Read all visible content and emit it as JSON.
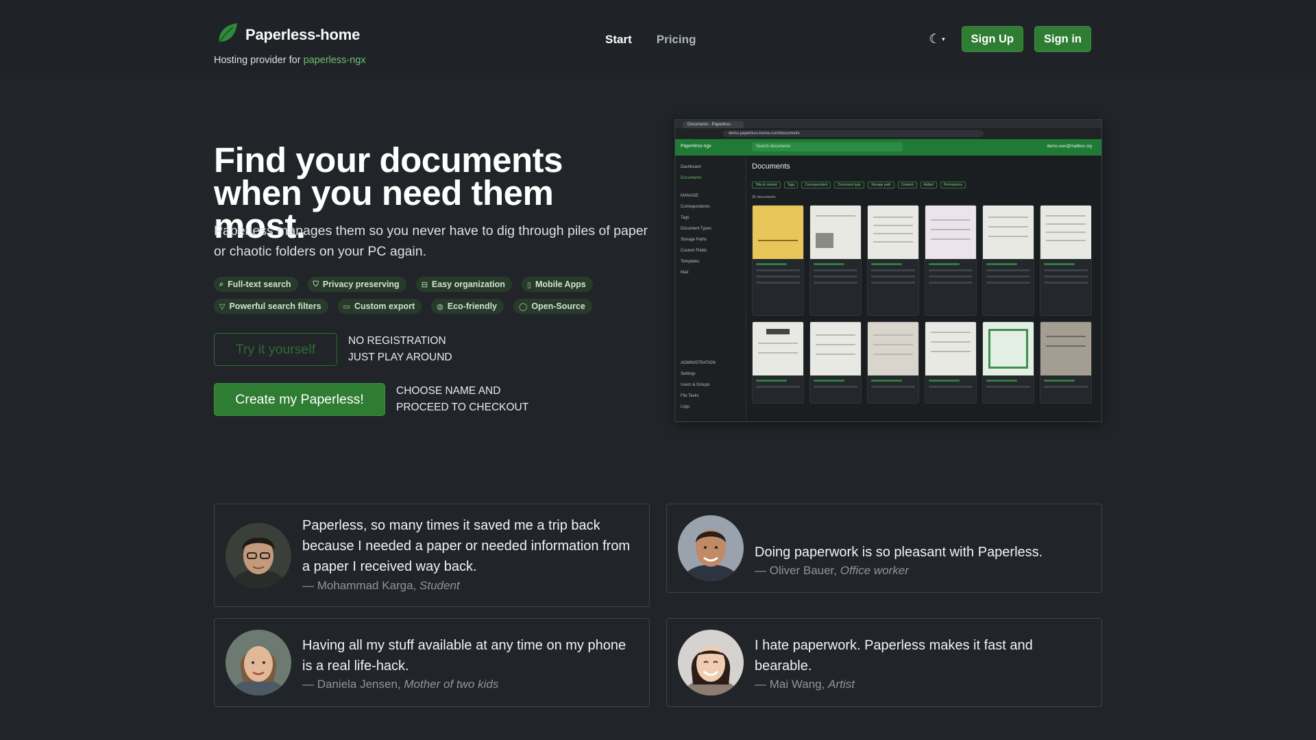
{
  "header": {
    "brand_name": "Paperless-home",
    "brand_sub_prefix": "Hosting provider for",
    "brand_sub_link": "paperless-ngx",
    "nav": [
      {
        "label": "Start",
        "active": true
      },
      {
        "label": "Pricing",
        "active": false
      }
    ],
    "theme_icon": "moon-icon",
    "signup_label": "Sign Up",
    "signin_label": "Sign in"
  },
  "hero": {
    "title": "Find your documents when you need them most.",
    "lead": "Paperless manages them so you never have to dig through piles of paper or chaotic folders on your PC again.",
    "features": [
      {
        "label": "Full-text search",
        "icon": "search-icon"
      },
      {
        "label": "Privacy preserving",
        "icon": "shield-icon"
      },
      {
        "label": "Easy organization",
        "icon": "inbox-icon"
      },
      {
        "label": "Mobile Apps",
        "icon": "phone-icon"
      },
      {
        "label": "Powerful search filters",
        "icon": "filter-icon"
      },
      {
        "label": "Custom export",
        "icon": "folder-icon"
      },
      {
        "label": "Eco-friendly",
        "icon": "globe-icon"
      },
      {
        "label": "Open-Source",
        "icon": "lightbulb-icon"
      }
    ],
    "try_label": "Try it yourself",
    "try_note_1": "NO REGISTRATION",
    "try_note_2": "JUST PLAY AROUND",
    "create_label": "Create my Paperless!",
    "create_note_1": "CHOOSE NAME AND",
    "create_note_2": "PROCEED TO CHECKOUT"
  },
  "screenshot": {
    "tab_title": "Documents - Paperless-",
    "url": "demo.paperless-home.com/documents",
    "app_name": "Paperless-ngx",
    "search_placeholder": "Search documents",
    "user": "demo-user@mailbox.org",
    "page_title": "Documents",
    "doc_count": "36 documents",
    "sidebar": [
      "Dashboard",
      "Documents",
      "MANAGE",
      "Correspondents",
      "Tags",
      "Document Types",
      "Storage Paths",
      "Custom Fields",
      "Templates",
      "Mail",
      "ADMINISTRATION",
      "Settings",
      "Users & Groups",
      "File Tasks",
      "Logs"
    ],
    "filters": [
      "Title & content",
      "Tags",
      "Correspondent",
      "Document type",
      "Storage path",
      "Created",
      "Added",
      "Permissions"
    ]
  },
  "testimonials": [
    {
      "quote": "Paperless, so many times it saved me a trip back because I needed a paper or needed information from a paper I received way back.",
      "name": "Mohammad Karga",
      "role": "Student"
    },
    {
      "quote": "Doing paperwork is so pleasant with Paperless.",
      "name": "Oliver Bauer",
      "role": "Office worker"
    },
    {
      "quote": "Having all my stuff available at any time on my phone is a real life-hack.",
      "name": "Daniela Jensen",
      "role": "Mother of two kids"
    },
    {
      "quote": "I hate paperwork. Paperless makes it fast and bearable.",
      "name": "Mai Wang",
      "role": "Artist"
    }
  ],
  "colors": {
    "background": "#212529",
    "brand_green": "#2f7d32",
    "link_green": "#6fbf73"
  }
}
